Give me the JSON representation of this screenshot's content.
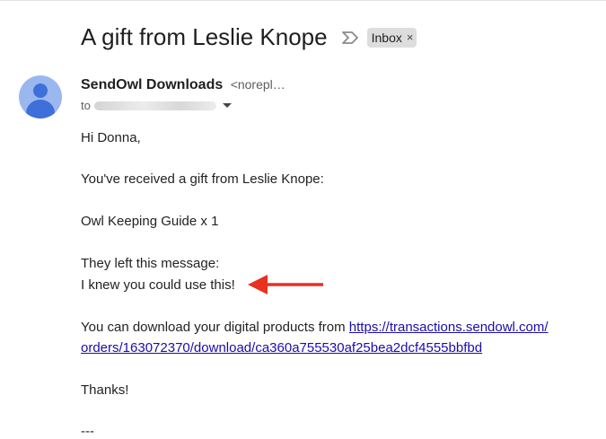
{
  "email": {
    "subject": "A gift from Leslie Knope",
    "label": "Inbox",
    "label_remove": "×",
    "sender_name": "SendOwl Downloads",
    "sender_email": "<norepl…",
    "to_prefix": "to",
    "body": {
      "greeting": "Hi Donna,",
      "line_gift": "You've received a gift from Leslie Knope:",
      "line_item": "Owl Keeping Guide x 1",
      "line_message_intro": "They left this message:",
      "line_message": "I knew you could use this!",
      "line_download": "You can download your digital products from",
      "link_part1": "https://transactions.sendowl.com/",
      "link_part2": "orders/163072370/download/ca360a755530af25bea2dcf4555bbfbd",
      "line_thanks": "Thanks!",
      "signature_sep": "---"
    }
  },
  "colors": {
    "annotation_arrow": "#e8311f",
    "link": "#1a0dab",
    "avatar": "#3f6fd8"
  }
}
